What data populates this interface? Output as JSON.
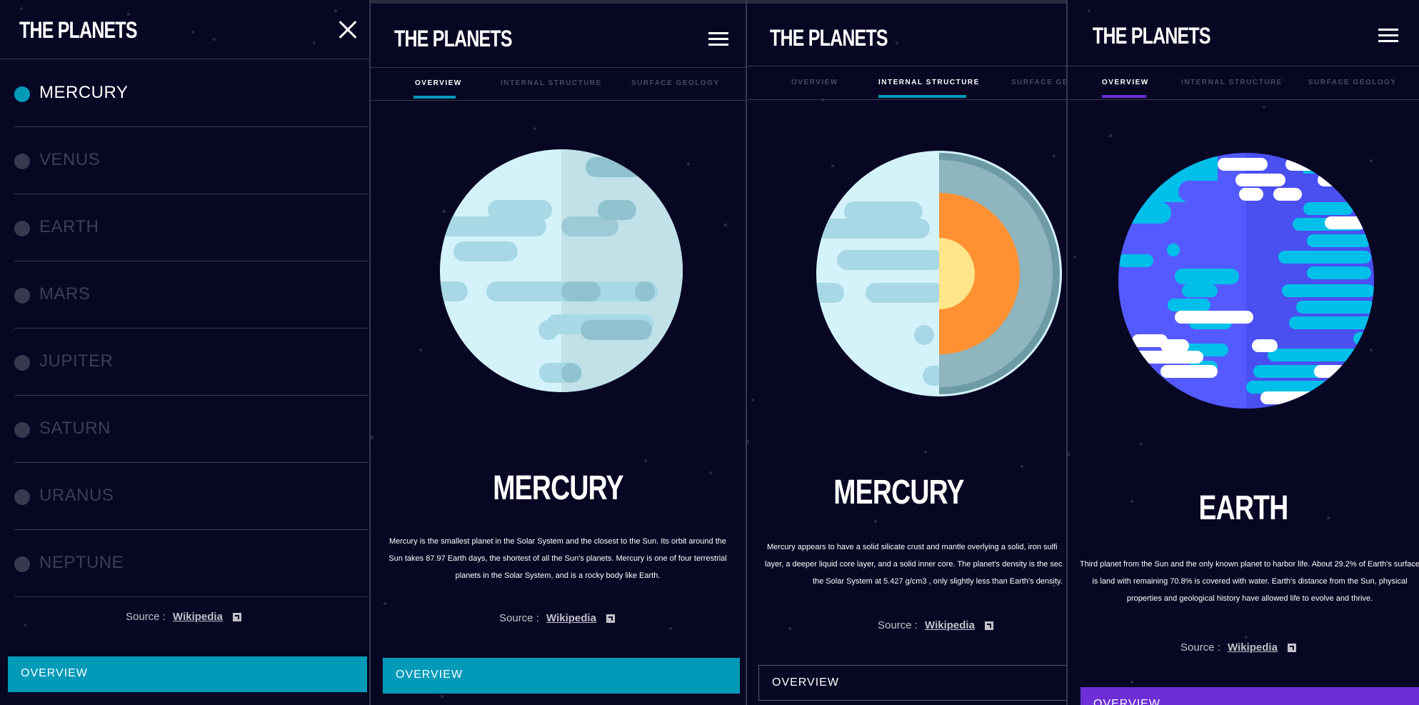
{
  "app": {
    "title": "THE PLANETS"
  },
  "colors": {
    "background": "#070724",
    "divider": "#38384f",
    "mercury": "#419ebb",
    "earth": "#6d2ed5",
    "button_teal": "#009ab9",
    "inactive_dot": "#38384f"
  },
  "menu": {
    "items": [
      {
        "label": "MERCURY",
        "active": true
      },
      {
        "label": "VENUS",
        "active": false
      },
      {
        "label": "EARTH",
        "active": false
      },
      {
        "label": "MARS",
        "active": false
      },
      {
        "label": "JUPITER",
        "active": false
      },
      {
        "label": "SATURN",
        "active": false
      },
      {
        "label": "URANUS",
        "active": false
      },
      {
        "label": "NEPTUNE",
        "active": false
      }
    ],
    "close_icon": "close-icon",
    "source_label": "Source :",
    "source_link": "Wikipedia",
    "button_label": "OVERVIEW"
  },
  "tabs": [
    "OVERVIEW",
    "INTERNAL STRUCTURE",
    "SURFACE GEOLOGY",
    "SURFACE GEO"
  ],
  "screens": [
    {
      "active_tab": "OVERVIEW",
      "planet_name": "MERCURY",
      "description": "Mercury is the smallest planet in the Solar System and the closest to the Sun. Its orbit around the Sun takes 87.97 Earth days, the shortest of all the Sun's planets. Mercury is one of four terrestrial planets in the Solar System, and is a rocky body like Earth.",
      "source_label": "Source :",
      "source_link": "Wikipedia",
      "button_label": "OVERVIEW"
    },
    {
      "active_tab": "INTERNAL STRUCTURE",
      "planet_name": "MERCURY",
      "description_lines": [
        "Mercury appears to have a solid silicate crust and mantle overlying a solid, iron sulfi",
        "layer, a deeper liquid core layer, and a solid inner core. The planet's density is the sec",
        "the Solar System at 5.427 g/cm3 , only slightly less than Earth's density."
      ],
      "source_label": "Source :",
      "source_link": "Wikipedia",
      "button_label": "OVERVIEW"
    },
    {
      "active_tab": "OVERVIEW",
      "planet_name": "EARTH",
      "description": "Third planet from the Sun and the only known planet to harbor life. About 29.2% of Earth's surface is land with remaining 70.8% is covered with water. Earth's distance from the Sun, physical properties and geological history have allowed life to evolve and thrive.",
      "source_label": "Source :",
      "source_link": "Wikipedia",
      "button_label": "OVERVIEW"
    }
  ]
}
